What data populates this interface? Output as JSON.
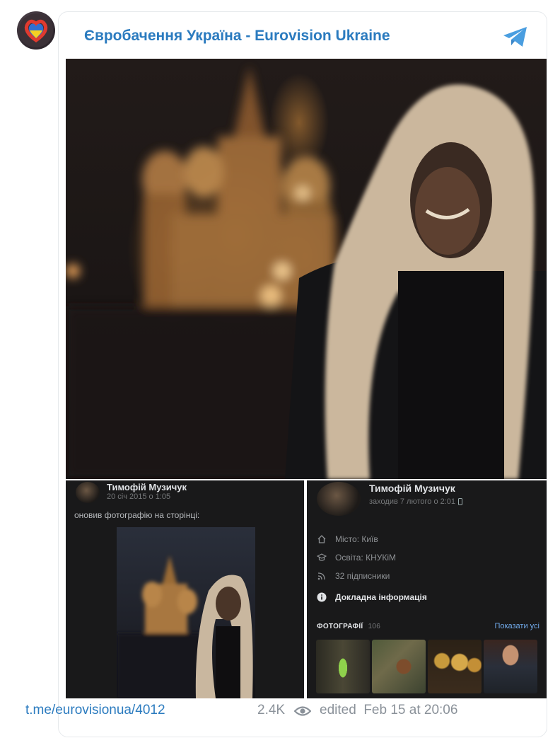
{
  "channel": {
    "title": "Євробачення Україна - Eurovision Ukraine"
  },
  "post_left": {
    "name": "Тимофій Музичук",
    "date": "20 січ 2015 о 1:05",
    "text": "оновив фотографію на сторінці:"
  },
  "profile": {
    "name": "Тимофій Музичук",
    "last_seen": "заходив 7 лютого о 2:01",
    "city": "Місто: Київ",
    "education": "Освіта: КНУКіМ",
    "followers": "32 підписники",
    "details": "Докладна інформація",
    "photos_label": "ФОТОГРАФІЇ",
    "photos_count": "106",
    "show_all": "Показати усі"
  },
  "footer": {
    "link": "t.me/eurovisionua/4012",
    "views": "2.4K",
    "edited": "edited  Feb 15 at 20:06"
  },
  "icons": {
    "telegram": "telegram-icon",
    "eye": "eye-icon",
    "home": "home-icon",
    "education": "graduation-cap-icon",
    "rss": "rss-icon",
    "info": "info-icon",
    "phone": "phone-icon"
  },
  "colors": {
    "accent": "#2b7bbf",
    "vk_bg": "#19191a",
    "vk_link": "#71aaeb"
  }
}
